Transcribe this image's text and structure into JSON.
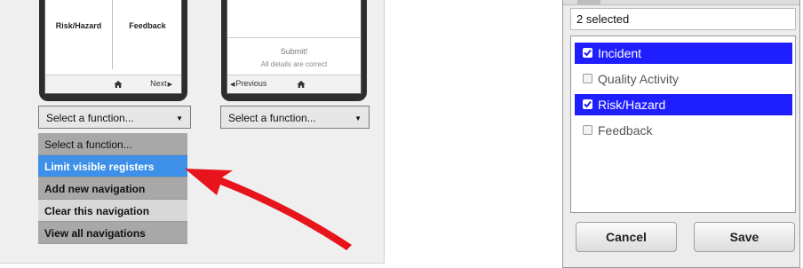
{
  "left_panel": {
    "phone1": {
      "tiles": [
        "Risk/Hazard",
        "Feedback"
      ],
      "next_label": "Next"
    },
    "phone2": {
      "submit_label": "Submit!",
      "details_text": "All details are correct",
      "previous_label": "Previous"
    },
    "select1": {
      "value": "Select a function..."
    },
    "select2": {
      "value": "Select a function..."
    },
    "dropdown_options": [
      "Select a function...",
      "Limit visible registers",
      "Add new navigation",
      "Clear this navigation",
      "View all navigations"
    ],
    "highlighted_option_index": 1,
    "arrow_color": "#e8141b"
  },
  "right_panel": {
    "selected_count": "2 selected",
    "options": [
      {
        "label": "Incident",
        "checked": true
      },
      {
        "label": "Quality Activity",
        "checked": false
      },
      {
        "label": "Risk/Hazard",
        "checked": true
      },
      {
        "label": "Feedback",
        "checked": false
      }
    ],
    "cancel_label": "Cancel",
    "save_label": "Save",
    "accent_color": "#1e1eff"
  }
}
